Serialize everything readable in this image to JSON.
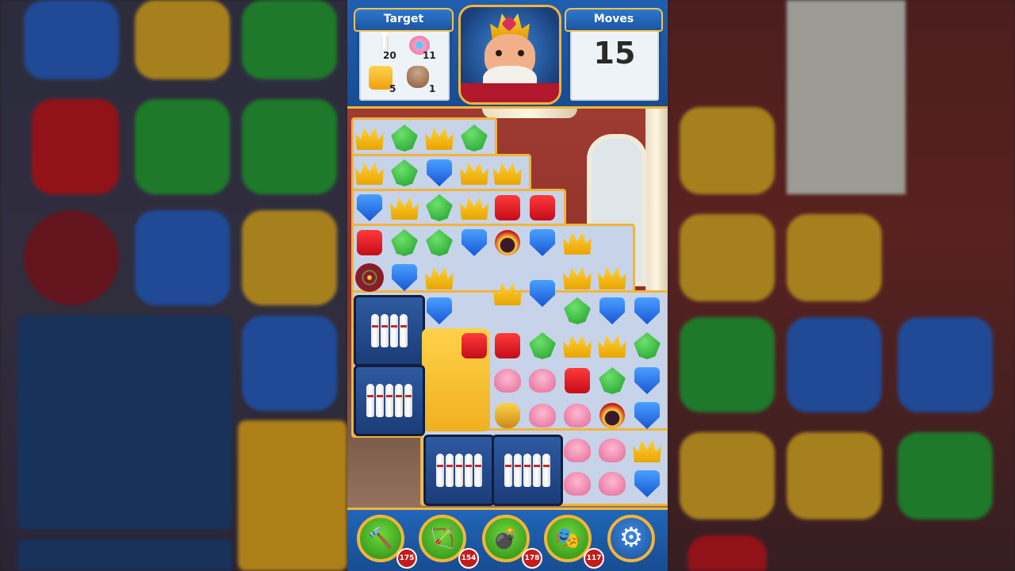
{
  "header": {
    "target_label": "Target",
    "moves_label": "Moves",
    "moves_value": "15"
  },
  "targets": [
    {
      "icon": "bowling-pin-icon",
      "count": "20"
    },
    {
      "icon": "pink-shell-icon",
      "count": "11"
    },
    {
      "icon": "honey-block-icon",
      "count": "5"
    },
    {
      "icon": "pot-icon",
      "count": "1"
    }
  ],
  "boosters": [
    {
      "icon": "hammer-icon",
      "count": "175"
    },
    {
      "icon": "arrow-icon",
      "count": "154"
    },
    {
      "icon": "cannon-icon",
      "count": "178"
    },
    {
      "icon": "jester-hat-icon",
      "count": "117"
    }
  ],
  "colors": {
    "bar_blue": "#1f5fb0",
    "gold_border": "#f2b43a",
    "booster_green": "#2a8a14",
    "count_red": "#c41b1b"
  }
}
